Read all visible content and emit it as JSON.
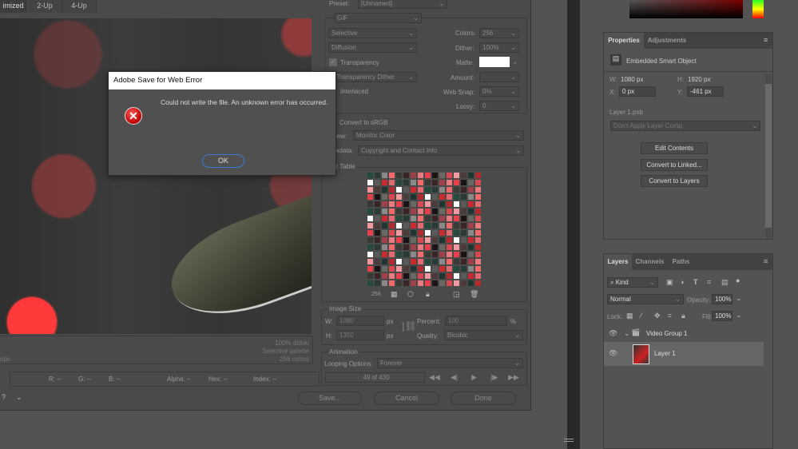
{
  "tabs": [
    "imized",
    "2-Up",
    "4-Up"
  ],
  "settings": {
    "preset_label": "Preset:",
    "preset_value": "[Unnamed]",
    "format": "GIF",
    "reduction": "Selective",
    "dither_algo": "Diffusion",
    "transparency": "Transparency",
    "transparency_dither": "o Transparency Dither",
    "interlaced": "Interlaced",
    "colors_label": "Colors:",
    "colors_value": "256",
    "dither_label": "Dither:",
    "dither_value": "100%",
    "matte_label": "Matte:",
    "amount_label": "Amount:",
    "websnap_label": "Web Snap:",
    "websnap_value": "0%",
    "lossy_label": "Lossy:",
    "lossy_value": "0",
    "convert_srgb": "Convert to sRGB",
    "preview_label": "iew:",
    "preview_value": "Monitor Color",
    "metadata_label": "adata:",
    "metadata_value": "Copyright and Contact Info",
    "color_table_label": "olor Table",
    "color_count": "256",
    "image_size_label": "Image Size",
    "w_label": "W:",
    "w_value": "1080",
    "h_label": "H:",
    "h_value": "1350",
    "px": "px",
    "percent_label": "Percent:",
    "percent_value": "100",
    "percent_unit": "%",
    "quality_label": "Quality:",
    "quality_value": "Bicubic",
    "animation_label": "Animation",
    "looping_label": "Looping Options:",
    "looping_value": "Forever",
    "frame_counter": "49 of 430"
  },
  "preview_info": {
    "line1": "100% dither",
    "line2": "Selective palette",
    "line3": "256 colors",
    "left_label": "ops"
  },
  "readout": {
    "r": "R: --",
    "g": "G: --",
    "b": "B: --",
    "alpha": "Alpha: --",
    "hex": "Hex: --",
    "index": "Index: --"
  },
  "buttons": {
    "save": "Save...",
    "cancel": "Cancel",
    "done": "Done"
  },
  "error_dialog": {
    "title": "Adobe Save for Web Error",
    "message": "Could not write the file. An unknown error has occurred.",
    "ok": "OK"
  },
  "properties": {
    "tab_properties": "Properties",
    "tab_adjustments": "Adjustments",
    "type": "Embedded Smart Object",
    "w_label": "W:",
    "w_value": "1080 px",
    "h_label": "H:",
    "h_value": "1920 px",
    "x_label": "X:",
    "x_value": "0 px",
    "y_label": "Y:",
    "y_value": "-461 px",
    "file": "Layer 1.psb",
    "layer_comp": "Don't Apply Layer Comp",
    "edit_contents": "Edit Contents",
    "convert_linked": "Convert to Linked...",
    "convert_layers": "Convert to Layers"
  },
  "layers": {
    "tab_layers": "Layers",
    "tab_channels": "Channels",
    "tab_paths": "Paths",
    "filter": "Kind",
    "blend_mode": "Normal",
    "opacity_label": "Opacity:",
    "opacity_value": "100%",
    "lock_label": "Lock:",
    "fill_label": "Fill:",
    "fill_value": "100%",
    "items": [
      {
        "name": "Video Group 1"
      },
      {
        "name": "Layer 1"
      }
    ]
  },
  "palette": [
    "#e8404a",
    "#2a3a36",
    "#1f3530",
    "#e87a80",
    "#244a3c",
    "#4a3a3a",
    "#a04048",
    "#e06a70",
    "#f09aa0",
    "#3a2424",
    "#c82a30",
    "#d84850",
    "#3a3a34",
    "#5a5a58",
    "#6a6a64",
    "#f26a6a",
    "#ffffff",
    "#1a1414",
    "#8a8a88",
    "#b02a30"
  ]
}
